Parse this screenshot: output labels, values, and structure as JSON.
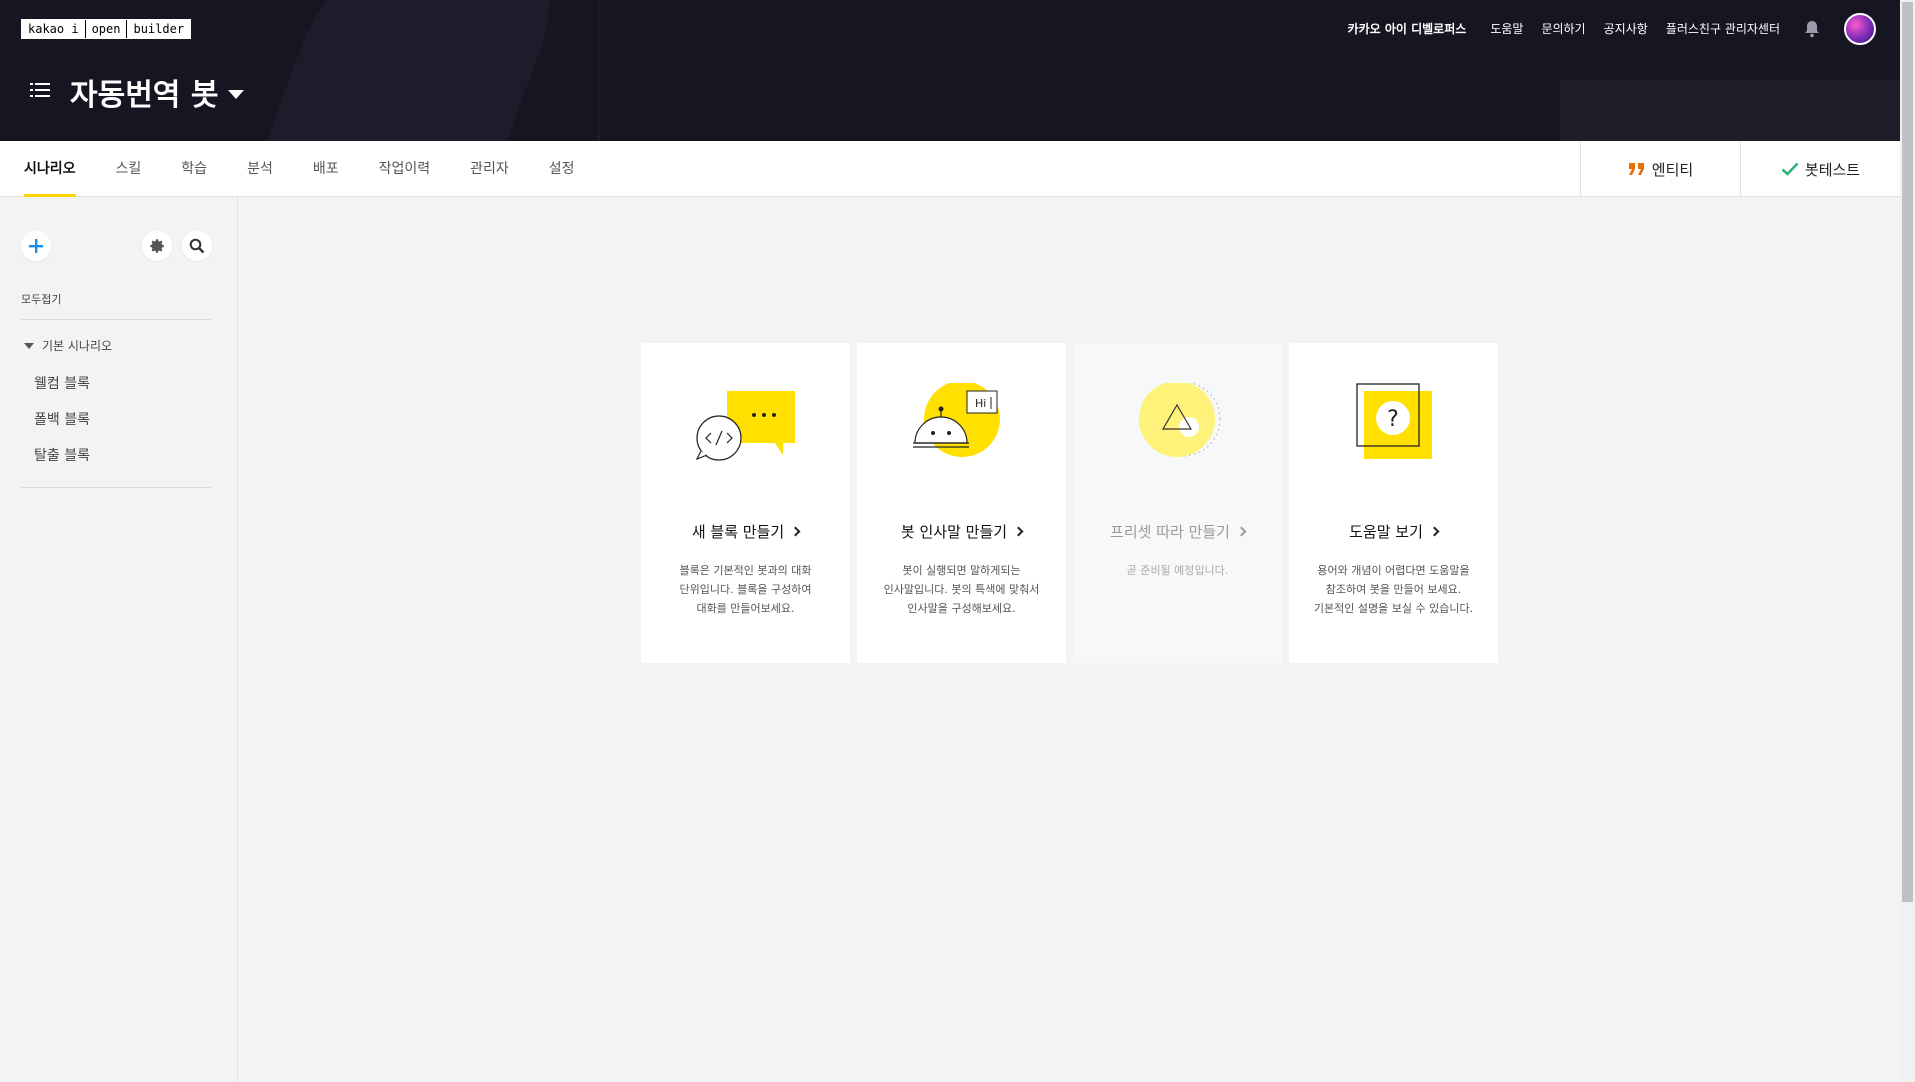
{
  "logo": {
    "parts": [
      "kakao i",
      "open",
      "builder"
    ]
  },
  "topnav": {
    "developers": "카카오 아이 디벨로퍼스",
    "help": "도움말",
    "inquiry": "문의하기",
    "notice": "공지사항",
    "admin_center": "플러스친구 관리자센터"
  },
  "bot": {
    "name": "자동번역 봇"
  },
  "tabs": [
    {
      "label": "시나리오"
    },
    {
      "label": "스킬"
    },
    {
      "label": "학습"
    },
    {
      "label": "분석"
    },
    {
      "label": "배포"
    },
    {
      "label": "작업이력"
    },
    {
      "label": "관리자"
    },
    {
      "label": "설정"
    }
  ],
  "tab_right": {
    "entity": "엔티티",
    "bot_test": "봇테스트"
  },
  "sidebar": {
    "collapse_all": "모두접기",
    "group": "기본 시나리오",
    "blocks": [
      {
        "label": "웰컴 블록"
      },
      {
        "label": "폴백 블록"
      },
      {
        "label": "탈출 블록"
      }
    ]
  },
  "cards": [
    {
      "title": "새 블록 만들기",
      "desc": "블록은 기본적인 봇과의 대화\n단위입니다. 블록을 구성하여\n대화를 만들어보세요."
    },
    {
      "title": "봇 인사말 만들기",
      "desc": "봇이 실행되면 말하게되는\n인사말입니다. 봇의 특색에 맞춰서\n인사말을 구성해보세요.",
      "bubble": "Hi"
    },
    {
      "title": "프리셋 따라 만들기",
      "desc": "곧 준비될 예정입니다."
    },
    {
      "title": "도움말 보기",
      "desc": "용어와 개념이 어렵다면 도움말을\n참조하여 봇을 만들어 보세요.\n기본적인 설명을 보실 수 있습니다.",
      "symbol": "?"
    }
  ],
  "colors": {
    "header_bg": "#161623",
    "accent": "#ffd200",
    "entity_icon": "#e8700a",
    "check": "#2db37a",
    "add": "#1a8fe6"
  },
  "icons": [
    "menu-icon",
    "bell-icon",
    "plus-icon",
    "gear-icon",
    "search-icon",
    "quote-icon",
    "check-icon"
  ]
}
